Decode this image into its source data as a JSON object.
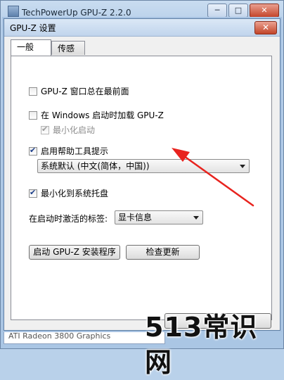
{
  "outer_window": {
    "title": "TechPowerUp GPU-Z 2.2.0",
    "minimize": "─",
    "maximize": "□",
    "close": "✕",
    "gpu_name": "ATI Radeon 3800 Graphics"
  },
  "dialog": {
    "title": "GPU-Z 设置",
    "close": "✕",
    "tabs": [
      {
        "label": "一般",
        "active": true
      },
      {
        "label": "传感器",
        "active": false
      }
    ],
    "general": {
      "always_on_top": {
        "label": "GPU-Z 窗口总在最前面",
        "checked": false
      },
      "load_on_startup": {
        "label": "在 Windows 启动时加载 GPU-Z",
        "checked": false
      },
      "minimize_on_startup": {
        "label": "最小化启动",
        "checked": true,
        "disabled": true
      },
      "enable_tooltips": {
        "label": "启用帮助工具提示",
        "checked": true
      },
      "language_select": {
        "value": "系统默认 (中文(简体，中国))"
      },
      "minimize_to_tray": {
        "label": "最小化到系统托盘",
        "checked": true
      },
      "startup_tab_label": "在启动时激活的标签:",
      "startup_tab_select": {
        "value": "显卡信息"
      },
      "install_button": "启动 GPU-Z 安装程序",
      "check_update_button": "检查更新"
    }
  },
  "watermark": "513常识网",
  "colors": {
    "arrow": "#e8231e",
    "dialog_bg": "#f0f0f0",
    "title_bar": "#c0d4ec"
  }
}
